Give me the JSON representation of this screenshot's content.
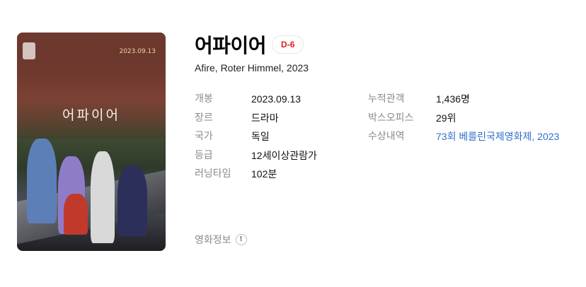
{
  "movie": {
    "title": "어파이어",
    "dday": "D-6",
    "subtitle": "Afire, Roter Himmel, 2023",
    "poster": {
      "title_text": "어파이어",
      "date_text": "2023.09.13"
    },
    "info_left": [
      {
        "label": "개봉",
        "value": "2023.09.13"
      },
      {
        "label": "장르",
        "value": "드라마"
      },
      {
        "label": "국가",
        "value": "독일"
      },
      {
        "label": "등급",
        "value": "12세이상관람가"
      },
      {
        "label": "러닝타임",
        "value": "102분"
      }
    ],
    "info_right": [
      {
        "label": "누적관객",
        "value": "1,436명"
      },
      {
        "label": "박스오피스",
        "value": "29위"
      },
      {
        "label": "수상내역",
        "value": "73회 베를린국제영화제, 2023"
      }
    ],
    "more_info_label": "영화정보",
    "link_color": "#2e6fc9",
    "dday_color": "#e02020"
  },
  "icons": {
    "expand": "expand-icon",
    "info": "info-icon"
  }
}
